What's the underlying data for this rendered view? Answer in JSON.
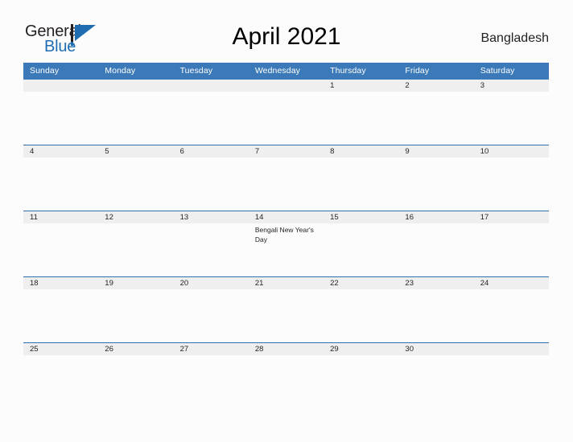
{
  "brand": {
    "word_one": "General",
    "word_two": "Blue",
    "mark_icon": "flag-triangle-icon",
    "mark_color": "#1f6cb0"
  },
  "header": {
    "title": "April 2021",
    "country": "Bangladesh"
  },
  "theme": {
    "header_blue": "#3b79b8",
    "row_border_blue": "#2f6fae",
    "band_gray": "#efefef",
    "page_background": "#fcfcfc",
    "text": "#231f20"
  },
  "calendar": {
    "weekday_headers": [
      "Sunday",
      "Monday",
      "Tuesday",
      "Wednesday",
      "Thursday",
      "Friday",
      "Saturday"
    ],
    "weeks": [
      [
        {
          "day": "",
          "events": []
        },
        {
          "day": "",
          "events": []
        },
        {
          "day": "",
          "events": []
        },
        {
          "day": "",
          "events": []
        },
        {
          "day": "1",
          "events": []
        },
        {
          "day": "2",
          "events": []
        },
        {
          "day": "3",
          "events": []
        }
      ],
      [
        {
          "day": "4",
          "events": []
        },
        {
          "day": "5",
          "events": []
        },
        {
          "day": "6",
          "events": []
        },
        {
          "day": "7",
          "events": []
        },
        {
          "day": "8",
          "events": []
        },
        {
          "day": "9",
          "events": []
        },
        {
          "day": "10",
          "events": []
        }
      ],
      [
        {
          "day": "11",
          "events": []
        },
        {
          "day": "12",
          "events": []
        },
        {
          "day": "13",
          "events": []
        },
        {
          "day": "14",
          "events": [
            "Bengali New Year's Day"
          ]
        },
        {
          "day": "15",
          "events": []
        },
        {
          "day": "16",
          "events": []
        },
        {
          "day": "17",
          "events": []
        }
      ],
      [
        {
          "day": "18",
          "events": []
        },
        {
          "day": "19",
          "events": []
        },
        {
          "day": "20",
          "events": []
        },
        {
          "day": "21",
          "events": []
        },
        {
          "day": "22",
          "events": []
        },
        {
          "day": "23",
          "events": []
        },
        {
          "day": "24",
          "events": []
        }
      ],
      [
        {
          "day": "25",
          "events": []
        },
        {
          "day": "26",
          "events": []
        },
        {
          "day": "27",
          "events": []
        },
        {
          "day": "28",
          "events": []
        },
        {
          "day": "29",
          "events": []
        },
        {
          "day": "30",
          "events": []
        },
        {
          "day": "",
          "events": []
        }
      ]
    ]
  }
}
